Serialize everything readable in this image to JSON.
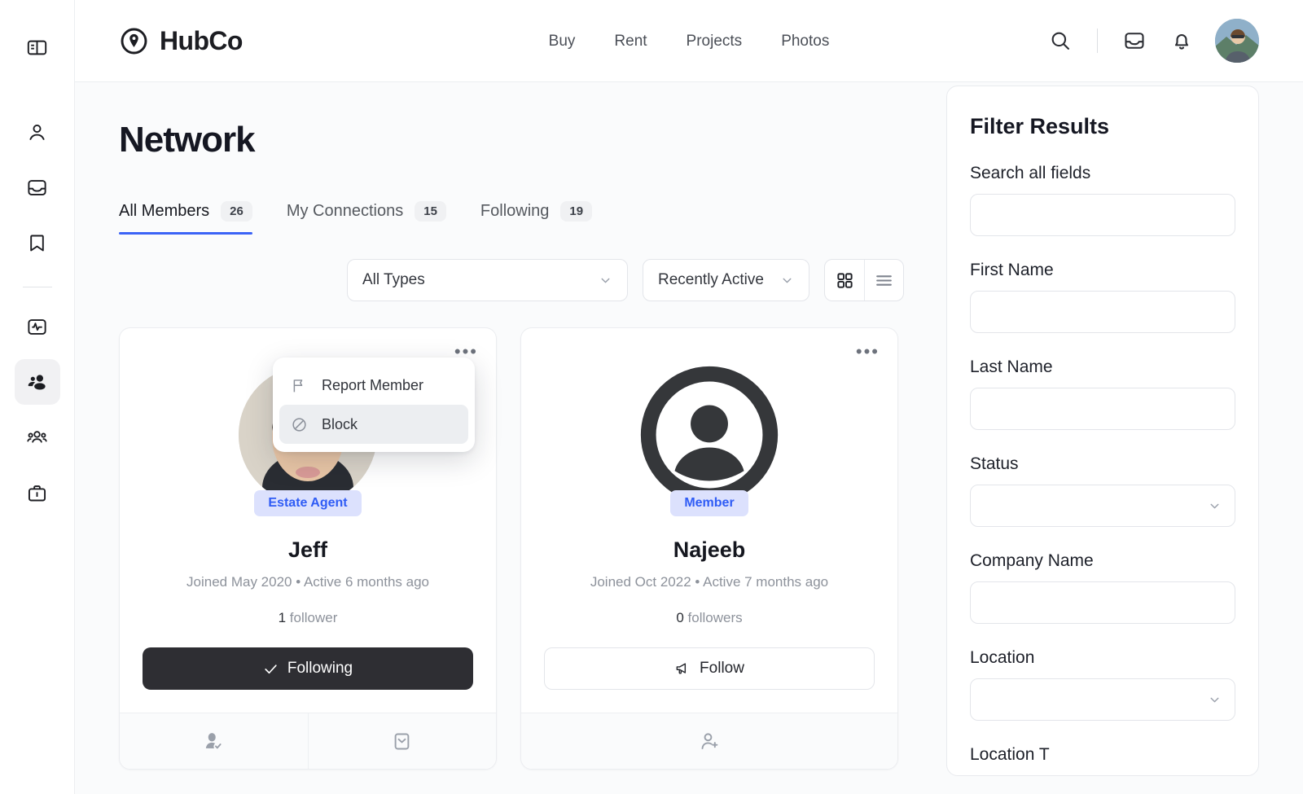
{
  "brand": {
    "name": "HubCo",
    "logo_icon": "map-pin-circle-icon"
  },
  "topnav": {
    "items": [
      {
        "label": "Buy"
      },
      {
        "label": "Rent"
      },
      {
        "label": "Projects"
      },
      {
        "label": "Photos"
      }
    ]
  },
  "topbar_actions": {
    "search_icon": "search-icon",
    "inbox_icon": "inbox-icon",
    "notifications_icon": "bell-icon",
    "avatar": "user-avatar"
  },
  "sidebar": {
    "items": [
      {
        "icon": "panel-toggle-icon",
        "active": false
      },
      {
        "icon": "person-icon",
        "active": false
      },
      {
        "icon": "inbox-icon",
        "active": false
      },
      {
        "icon": "bookmark-icon",
        "active": false
      },
      {
        "icon": "activity-icon",
        "active": false
      },
      {
        "icon": "people-icon",
        "active": true
      },
      {
        "icon": "group-icon",
        "active": false
      },
      {
        "icon": "briefcase-icon",
        "active": false
      }
    ]
  },
  "page": {
    "title": "Network"
  },
  "tabs": [
    {
      "label": "All Members",
      "count": "26",
      "active": true
    },
    {
      "label": "My Connections",
      "count": "15",
      "active": false
    },
    {
      "label": "Following",
      "count": "19",
      "active": false
    }
  ],
  "controls": {
    "type_filter": {
      "value": "All Types",
      "icon": "chevron-down-icon"
    },
    "sort": {
      "value": "Recently Active",
      "icon": "chevron-down-icon"
    },
    "grid_view_icon": "grid-view-icon",
    "list_view_icon": "list-view-icon",
    "grid_view_active": true
  },
  "context_menu": {
    "items": [
      {
        "label": "Report Member",
        "icon": "flag-icon",
        "hovered": false
      },
      {
        "label": "Block",
        "icon": "block-icon",
        "hovered": true
      }
    ]
  },
  "members": [
    {
      "badge": "Estate Agent",
      "name": "Jeff",
      "meta": "Joined May 2020 • Active 6 months ago",
      "followers_count": "1",
      "followers_label": "follower",
      "cta": {
        "label": "Following",
        "icon": "check-icon",
        "style": "dark"
      },
      "avatar_type": "photo",
      "footer_icons": [
        "person-check-icon",
        "envelope-icon"
      ],
      "menu_icon": "ellipsis-icon"
    },
    {
      "badge": "Member",
      "name": "Najeeb",
      "meta": "Joined Oct 2022 • Active 7 months ago",
      "followers_count": "0",
      "followers_label": "followers",
      "cta": {
        "label": "Follow",
        "icon": "megaphone-icon",
        "style": "outline"
      },
      "avatar_type": "default",
      "footer_icons": [
        "person-plus-icon"
      ],
      "menu_icon": "ellipsis-icon"
    }
  ],
  "filter_panel": {
    "title": "Filter Results",
    "fields": [
      {
        "label": "Search all fields",
        "type": "input",
        "value": ""
      },
      {
        "label": "First Name",
        "type": "input",
        "value": ""
      },
      {
        "label": "Last Name",
        "type": "input",
        "value": ""
      },
      {
        "label": "Status",
        "type": "select",
        "value": "",
        "icon": "chevron-down-icon"
      },
      {
        "label": "Company Name",
        "type": "input",
        "value": ""
      },
      {
        "label": "Location",
        "type": "select",
        "value": "",
        "icon": "chevron-down-icon"
      },
      {
        "label": "Location T",
        "type": "clipped",
        "value": ""
      }
    ]
  },
  "colors": {
    "accent": "#3b63f6",
    "badge_bg": "#dce1fd",
    "badge_text": "#2f5cf5",
    "dark_button": "#2e2e33",
    "page_bg": "#fafbfc"
  }
}
